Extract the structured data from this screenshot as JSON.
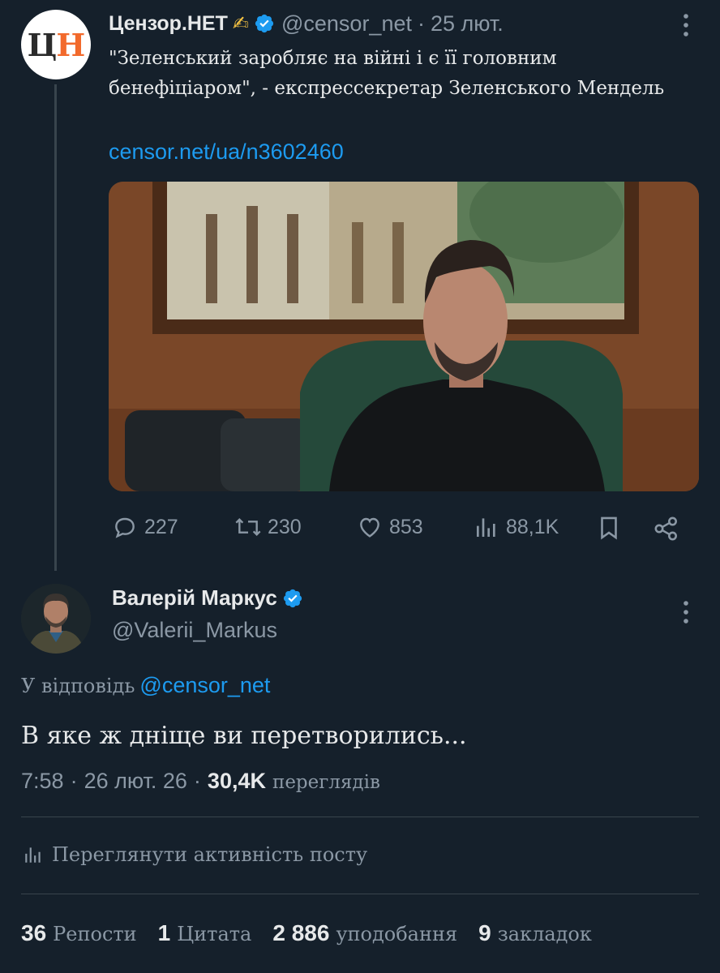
{
  "parent_tweet": {
    "avatar_letters": [
      "Ц",
      "Н"
    ],
    "author_name": "Цензор.НЕТ",
    "author_emoji": "✍",
    "handle": "@censor_net",
    "separator": "·",
    "date": "25 лют.",
    "text": "\"Зеленський заробляє на війні і є її головним бенефіціаром\", - експрессекретар Зеленського Мендель",
    "link": "censor.net/ua/n3602460",
    "actions": {
      "replies": "227",
      "reposts": "230",
      "likes": "853",
      "views": "88,1K"
    }
  },
  "reply_tweet": {
    "author_name": "Валерій Маркус",
    "handle": "@Valerii_Markus",
    "replying_to_label": "У відповідь",
    "replying_to_handle": "@censor_net",
    "text": "В яке ж дніще ви перетворились...",
    "time": "7:58",
    "separator": "·",
    "date": "26 лют. 26",
    "views_count": "30,4K",
    "views_label": "переглядів",
    "activity_label": "Переглянути активність посту",
    "stats": {
      "reposts_count": "36",
      "reposts_label": "Репости",
      "quotes_count": "1",
      "quotes_label": "Цитата",
      "likes_count": "2 886",
      "likes_label": "уподобання",
      "bookmarks_count": "9",
      "bookmarks_label": "закладок"
    }
  },
  "colors": {
    "background": "#15202b",
    "text": "#e7e9ea",
    "muted": "#8b98a5",
    "accent": "#1d9bf0",
    "divider": "#38444d"
  },
  "icons": [
    "verified-badge-icon",
    "more-options-icon",
    "reply-icon",
    "repost-icon",
    "like-icon",
    "views-icon",
    "bookmark-icon",
    "share-icon",
    "activity-icon"
  ]
}
